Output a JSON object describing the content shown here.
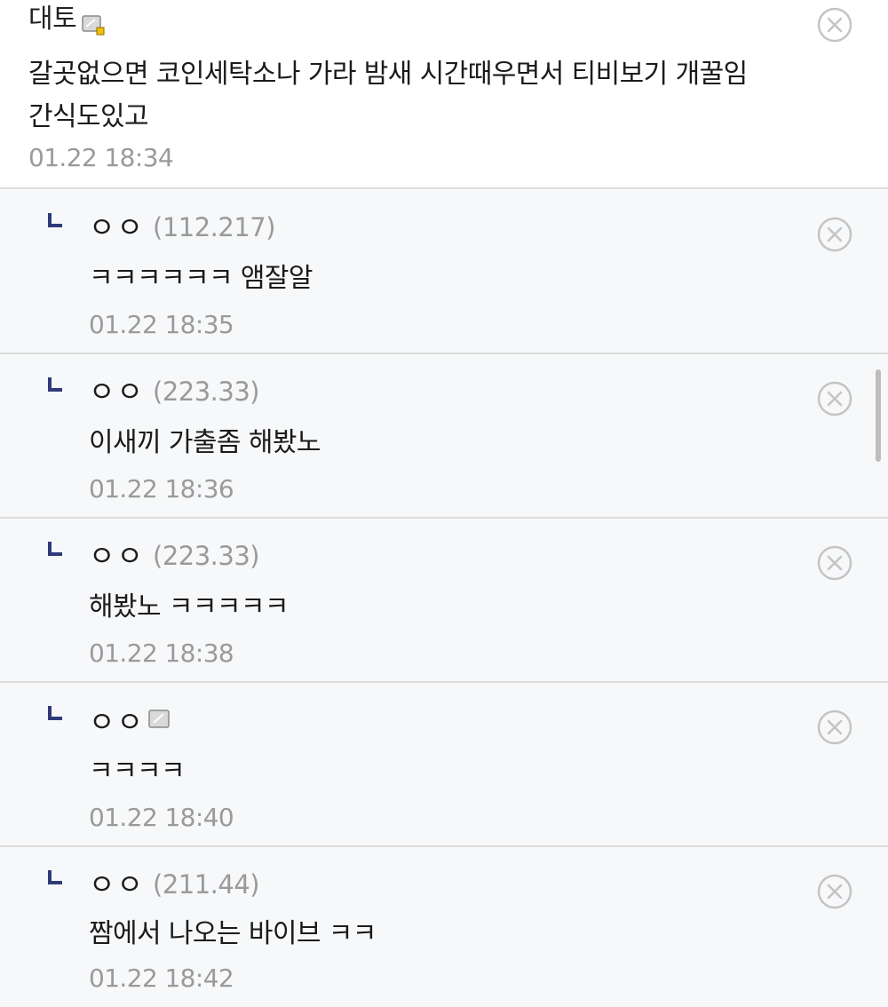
{
  "main_comment": {
    "nickname": "대토",
    "text": "갈곳없으면 코인세탁소나 가라 밤새 시간때우면서 티비보기 개꿀임 간식도있고",
    "time": "01.22 18:34"
  },
  "replies": [
    {
      "nickname": "ㅇㅇ",
      "ip": "(112.217)",
      "text": "ㅋㅋㅋㅋㅋㅋ 앰잘알",
      "time": "01.22 18:35"
    },
    {
      "nickname": "ㅇㅇ",
      "ip": "(223.33)",
      "text": "이새끼 가출좀 해봤노",
      "time": "01.22 18:36"
    },
    {
      "nickname": "ㅇㅇ",
      "ip": "(223.33)",
      "text": "해봤노 ㅋㅋㅋㅋㅋ",
      "time": "01.22 18:38"
    },
    {
      "nickname": "ㅇㅇ",
      "ip": "",
      "text": "ㅋㅋㅋㅋ",
      "time": "01.22 18:40"
    },
    {
      "nickname": "ㅇㅇ",
      "ip": "(211.44)",
      "text": "짬에서 나오는 바이브 ㅋㅋ",
      "time": "01.22 18:42"
    }
  ],
  "colors": {
    "reply_background": "#f7f8fa",
    "reply_arrow": "#2f3a7a",
    "timestamp": "#9a9a9a",
    "divider": "#dcdcdc"
  },
  "icons": {
    "delete": "close-circle-icon",
    "user_badge": "gallog-icon",
    "reply_marker": "reply-arrow-icon"
  }
}
